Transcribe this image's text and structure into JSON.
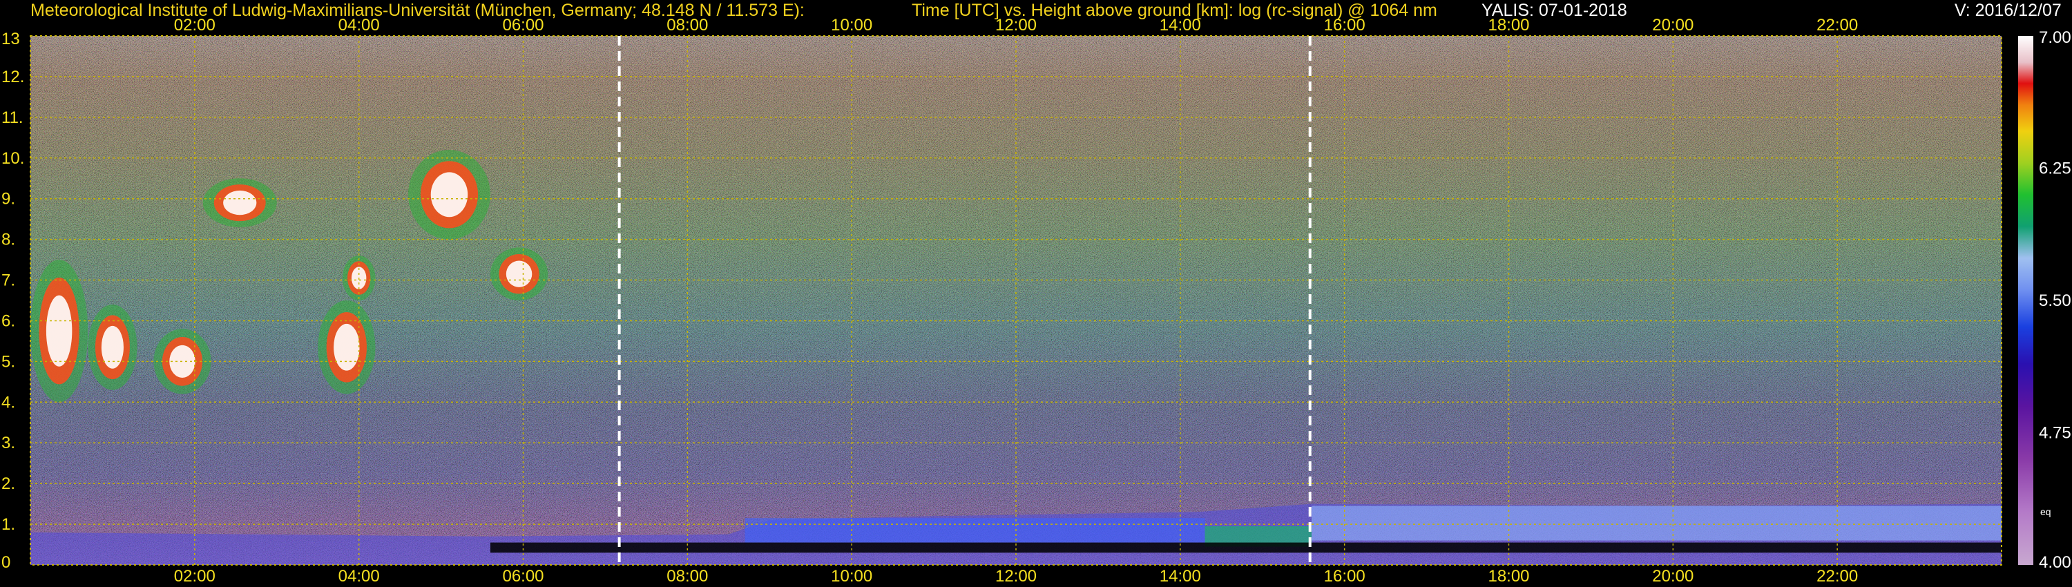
{
  "header": {
    "institute": "Meteorological Institute of Ludwig-Maximilians-Universität (München, Germany; 48.148 N / 11.573 E):",
    "description": "Time [UTC] vs. Height above ground [km]: log (rc-signal) @ 1064 nm",
    "instrument_date": "YALIS: 07-01-2018",
    "version": "V: 2016/12/07"
  },
  "colors": {
    "background": "#000000",
    "axis_text": "#f5e020",
    "grid": "#c8b400",
    "cloud_core": "#ffffff",
    "cloud_edge": "#ff4a1c"
  },
  "chart_data": {
    "type": "heatmap",
    "x_axis": {
      "unit": "UTC",
      "range": [
        "00:00",
        "24:00"
      ],
      "ticks": [
        "02:00",
        "04:00",
        "06:00",
        "08:00",
        "10:00",
        "12:00",
        "14:00",
        "16:00",
        "18:00",
        "20:00",
        "22:00"
      ],
      "tick_hours": [
        2,
        4,
        6,
        8,
        10,
        12,
        14,
        16,
        18,
        20,
        22
      ]
    },
    "y_axis": {
      "unit": "km",
      "range": [
        0,
        13
      ],
      "ticks": [
        "0",
        "1.",
        "2.",
        "3.",
        "4.",
        "5.",
        "6.",
        "7.",
        "8.",
        "9.",
        "10.",
        "11.",
        "12.",
        "13"
      ],
      "tick_values": [
        0,
        1,
        2,
        3,
        4,
        5,
        6,
        7,
        8,
        9,
        10,
        11,
        12,
        13
      ]
    },
    "grid": true,
    "colorbar": {
      "range": [
        4.0,
        7.0
      ],
      "labels": [
        "7.00",
        "6.25",
        "5.50",
        "4.75",
        "4.00"
      ],
      "label_values": [
        7.0,
        6.25,
        5.5,
        4.75,
        4.0
      ],
      "extra_label": "eq"
    },
    "marker_lines_hours": [
      7.17,
      15.58
    ],
    "features": {
      "boundary_layer_top_km": [
        {
          "hour": 0.0,
          "km": 0.8
        },
        {
          "hour": 5.5,
          "km": 0.7
        },
        {
          "hour": 8.5,
          "km": 0.75
        },
        {
          "hour": 9.0,
          "km": 1.1
        },
        {
          "hour": 11.0,
          "km": 1.2
        },
        {
          "hour": 14.2,
          "km": 1.3
        },
        {
          "hour": 15.6,
          "km": 1.5
        },
        {
          "hour": 20.0,
          "km": 1.45
        },
        {
          "hour": 24.0,
          "km": 1.5
        }
      ],
      "clouds": [
        {
          "start_hour": 0.0,
          "end_hour": 0.7,
          "base_km": 4.0,
          "top_km": 7.5
        },
        {
          "start_hour": 0.7,
          "end_hour": 1.3,
          "base_km": 4.3,
          "top_km": 6.4
        },
        {
          "start_hour": 1.5,
          "end_hour": 2.2,
          "base_km": 4.2,
          "top_km": 5.8
        },
        {
          "start_hour": 2.1,
          "end_hour": 3.0,
          "base_km": 8.3,
          "top_km": 9.5
        },
        {
          "start_hour": 3.5,
          "end_hour": 4.2,
          "base_km": 4.2,
          "top_km": 6.5
        },
        {
          "start_hour": 3.8,
          "end_hour": 4.2,
          "base_km": 6.5,
          "top_km": 7.6
        },
        {
          "start_hour": 4.6,
          "end_hour": 5.6,
          "base_km": 8.0,
          "top_km": 10.2
        },
        {
          "start_hour": 5.6,
          "end_hour": 6.3,
          "base_km": 6.5,
          "top_km": 7.8
        }
      ]
    }
  }
}
